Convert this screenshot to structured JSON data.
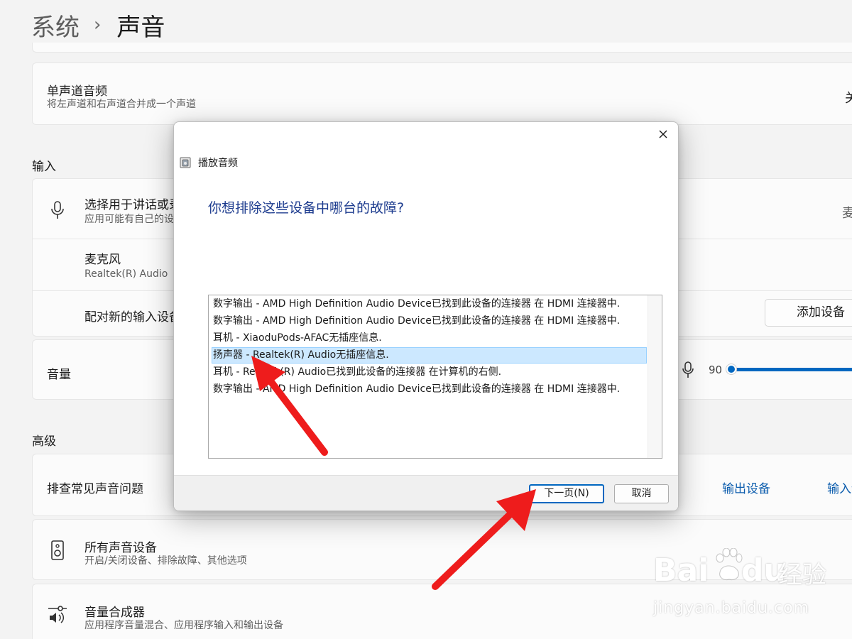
{
  "breadcrumb": {
    "parent": "系统",
    "separator": "›",
    "current": "声音"
  },
  "mono": {
    "title": "单声道音频",
    "subtitle": "将左声道和右声道合并成一个声道",
    "value": "关"
  },
  "input_section": {
    "label": "输入"
  },
  "input_device": {
    "title": "选择用于讲话或录制的设备",
    "subtitle": "应用可能有自己的设置",
    "value": "麦克风"
  },
  "microphone": {
    "name": "麦克风",
    "driver": "Realtek(R) Audio"
  },
  "pair_input": {
    "title": "配对新的输入设备",
    "button": "添加设备"
  },
  "volume": {
    "label": "音量",
    "value": "90",
    "level": 0.9
  },
  "advanced_section": {
    "label": "高级"
  },
  "troubleshoot": {
    "title": "排查常见声音问题",
    "output_link": "输出设备",
    "input_link": "输入设备"
  },
  "all_devices": {
    "title": "所有声音设备",
    "subtitle": "开启/关闭设备、排除故障、其他选项"
  },
  "mixer": {
    "title": "音量合成器",
    "subtitle": "应用程序音量混合、应用程序输入和输出设备"
  },
  "dialog": {
    "title": "播放音频",
    "heading": "你想排除这些设备中哪台的故障?",
    "items": [
      "数字输出 - AMD High Definition Audio Device已找到此设备的连接器 在 HDMI 连接器中.",
      "数字输出 - AMD High Definition Audio Device已找到此设备的连接器 在 HDMI 连接器中.",
      "耳机 - XiaoduPods-AFAC无插座信息.",
      "扬声器 - Realtek(R) Audio无插座信息.",
      "耳机 - Realtek(R) Audio已找到此设备的连接器 在计算机的右侧.",
      "数字输出 - AMD High Definition Audio Device已找到此设备的连接器 在 HDMI 连接器中."
    ],
    "selected_index": 3,
    "next_button": "下一页(N)",
    "cancel_button": "取消"
  },
  "annotation": {
    "color": "#ee1c1c"
  },
  "watermark": {
    "brand_latin_1": "Bai",
    "brand_latin_2": "du",
    "brand_cn": "经验",
    "url": "jingyan.baidu.com"
  },
  "colors": {
    "accent": "#0067c0",
    "link": "#0b5cad",
    "dialog_heading": "#1c3b8e",
    "selection": "#cce8ff"
  }
}
